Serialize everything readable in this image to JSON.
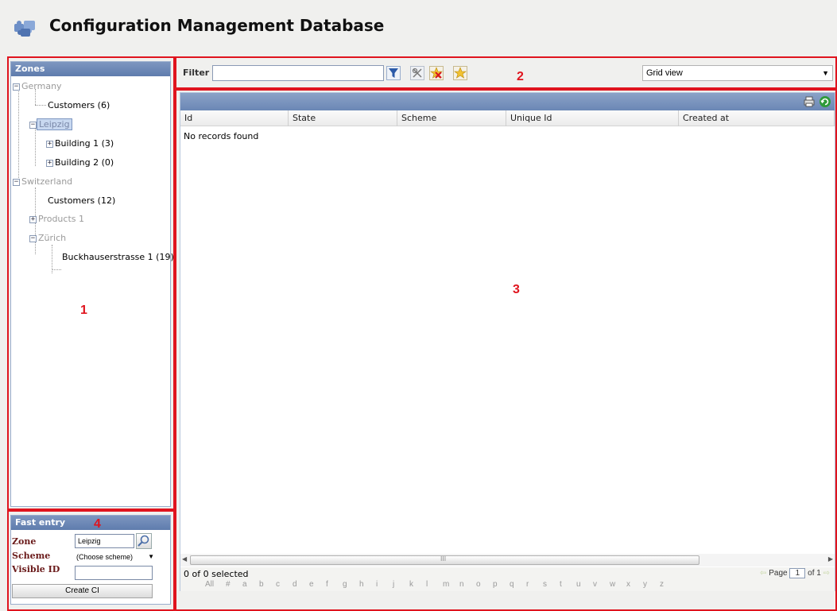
{
  "app": {
    "title": "Configuration Management Database"
  },
  "zones": {
    "header": "Zones",
    "tree": [
      {
        "label": "Germany",
        "style": "grey",
        "expander": "minus"
      },
      {
        "label": "Customers (6)",
        "style": "dark",
        "expander": ""
      },
      {
        "label": "Leipzig",
        "style": "selected",
        "expander": "minus"
      },
      {
        "label": "Building 1 (3)",
        "style": "dark",
        "expander": "plus"
      },
      {
        "label": "Building 2 (0)",
        "style": "dark",
        "expander": "plus"
      },
      {
        "label": "Switzerland",
        "style": "grey",
        "expander": "minus"
      },
      {
        "label": "Customers (12)",
        "style": "dark",
        "expander": ""
      },
      {
        "label": "Products 1",
        "style": "grey",
        "expander": "plus"
      },
      {
        "label": "Zürich",
        "style": "grey",
        "expander": "minus"
      },
      {
        "label": "Buckhauserstrasse 1 (19)",
        "style": "dark",
        "expander": ""
      }
    ]
  },
  "fast_entry": {
    "header": "Fast entry",
    "zone_label": "Zone",
    "zone_value": "Leipzig",
    "scheme_label": "Scheme",
    "scheme_value": "(Choose scheme)",
    "visible_id_label": "Visible ID",
    "visible_id_value": "",
    "create_button": "Create CI"
  },
  "filter": {
    "label": "Filter",
    "value": "",
    "view_select": "Grid view",
    "icons": [
      "filter-icon",
      "clear-filter-icon",
      "remove-favorite-icon",
      "favorite-icon"
    ]
  },
  "grid": {
    "columns": [
      "Id",
      "State",
      "Scheme",
      "Unique Id",
      "Created at"
    ],
    "empty_text": "No records found",
    "selected_text": "0 of 0 selected",
    "page_label": "Page",
    "page_value": "1",
    "of_label": "of 1",
    "alphabet": [
      "All",
      "#",
      "a",
      "b",
      "c",
      "d",
      "e",
      "f",
      "g",
      "h",
      "i",
      "j",
      "k",
      "l",
      "m",
      "n",
      "o",
      "p",
      "q",
      "r",
      "s",
      "t",
      "u",
      "v",
      "w",
      "x",
      "y",
      "z"
    ],
    "scroll_grip": "III"
  },
  "annotations": [
    "1",
    "2",
    "3",
    "4"
  ],
  "colors": {
    "annotation_red": "#e0141e",
    "panel_header_blue": "#6b87b5",
    "label_maroon": "#6a1a1a"
  }
}
